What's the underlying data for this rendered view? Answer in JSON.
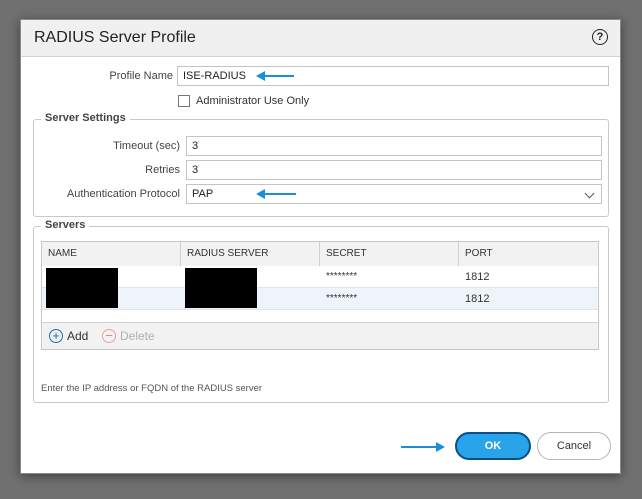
{
  "dialog": {
    "title": "RADIUS Server Profile",
    "help_glyph": "?"
  },
  "profile": {
    "name_label": "Profile Name",
    "name_value": "ISE-RADIUS",
    "admin_only_label": "Administrator Use Only",
    "admin_only_checked": false
  },
  "server_settings": {
    "legend": "Server Settings",
    "timeout_label": "Timeout (sec)",
    "timeout_value": "3",
    "retries_label": "Retries",
    "retries_value": "3",
    "auth_label": "Authentication Protocol",
    "auth_value": "PAP"
  },
  "servers": {
    "legend": "Servers",
    "columns": [
      "NAME",
      "RADIUS SERVER",
      "SECRET",
      "PORT"
    ],
    "rows": [
      {
        "name": "",
        "server": "",
        "secret": "********",
        "port": "1812"
      },
      {
        "name": "",
        "server": "",
        "secret": "********",
        "port": "1812"
      }
    ],
    "add_label": "Add",
    "delete_label": "Delete",
    "hint": "Enter the IP address or FQDN of the RADIUS server"
  },
  "footer": {
    "ok_label": "OK",
    "cancel_label": "Cancel"
  },
  "colors": {
    "accent": "#1a8fd6",
    "ok_button": "#29a3ea"
  },
  "icons": [
    "help-icon",
    "arrow-left-icon",
    "arrow-right-icon",
    "chevron-down-icon",
    "plus-circle-icon",
    "minus-circle-icon"
  ]
}
